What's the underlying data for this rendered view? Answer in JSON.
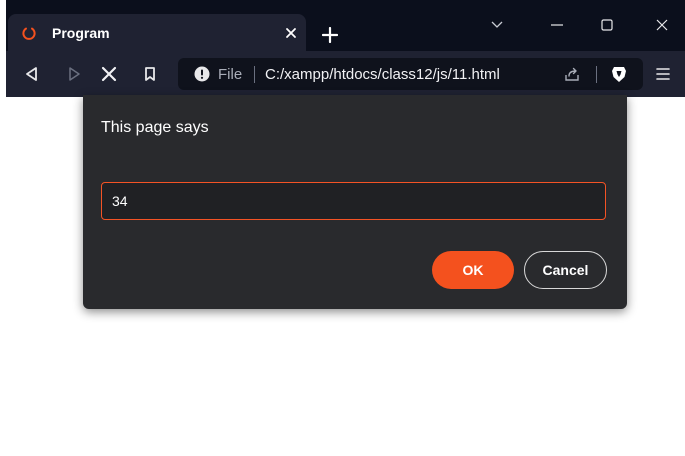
{
  "tab": {
    "title": "Program"
  },
  "address_bar": {
    "scheme_label": "File",
    "url": "C:/xampp/htdocs/class12/js/11.html"
  },
  "dialog": {
    "title": "This page says",
    "input_value": "34",
    "ok_label": "OK",
    "cancel_label": "Cancel"
  },
  "colors": {
    "accent": "#f4511e",
    "tab_strip": "#0b0f1c",
    "toolbar": "#1f2232",
    "dialog_bg": "#292a2d"
  },
  "icons": {
    "tab": [
      "loading-spinner-icon",
      "close-icon"
    ],
    "toolbar": [
      "back-icon",
      "forward-icon",
      "stop-icon",
      "bookmark-icon",
      "info-icon",
      "share-icon",
      "brave-shields-icon",
      "menu-icon"
    ],
    "window": [
      "chevron-down-icon",
      "minimize-icon",
      "maximize-icon",
      "close-icon"
    ]
  }
}
